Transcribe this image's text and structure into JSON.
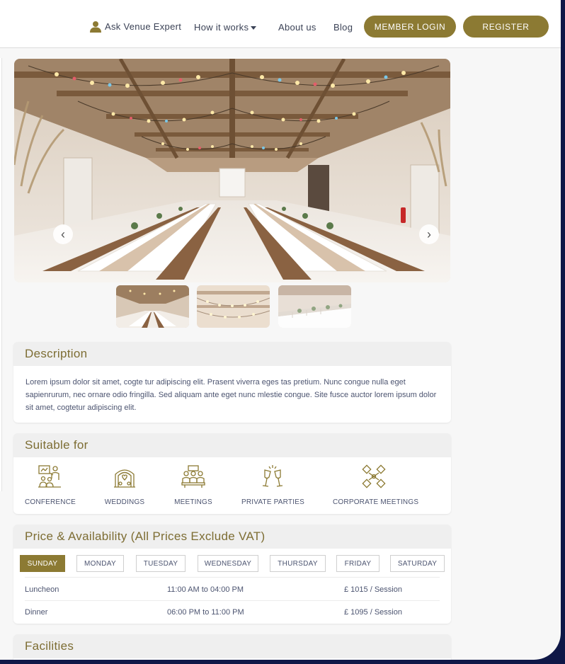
{
  "nav": {
    "ask_label": "Ask Venue Expert",
    "how_label": "How it works",
    "about_label": "About us",
    "blog_label": "Blog",
    "login_label": "MEMBER LOGIN",
    "register_label": "REGISTER"
  },
  "gallery": {
    "prev_glyph": "‹",
    "next_glyph": "›",
    "thumbnail_count": 3
  },
  "description": {
    "title": "Description",
    "text": "Lorem ipsum dolor sit amet, cogte tur adipiscing elit. Prasent viverra eges tas pretium. Nunc congue nulla eget sapienrurum, nec ornare odio fringilla. Sed aliquam ante eget nunc mlestie congue. Site fusce auctor lorem ipsum dolor sit amet, cogtetur adipiscing elit."
  },
  "suitable": {
    "title": "Suitable for",
    "items": [
      {
        "label": "CONFERENCE",
        "icon": "conference-icon"
      },
      {
        "label": "WEDDINGS",
        "icon": "wedding-icon"
      },
      {
        "label": "MEETINGS",
        "icon": "meetings-icon"
      },
      {
        "label": "PRIVATE PARTIES",
        "icon": "champagne-icon"
      },
      {
        "label": "CORPORATE MEETINGS",
        "icon": "handshake-icon"
      }
    ]
  },
  "pricing": {
    "title": "Price & Availability (All Prices Exclude VAT)",
    "days": [
      "SUNDAY",
      "MONDAY",
      "TUESDAY",
      "WEDNESDAY",
      "THURSDAY",
      "FRIDAY",
      "SATURDAY"
    ],
    "active_day": "SUNDAY",
    "sessions": [
      {
        "name": "Luncheon",
        "time": "11:00 AM to 04:00 PM",
        "price": "£ 1015 / Session"
      },
      {
        "name": "Dinner",
        "time": "06:00 PM to 11:00 PM",
        "price": "£ 1095 / Session"
      }
    ]
  },
  "facilities": {
    "title": "Facilities"
  },
  "colors": {
    "accent": "#8c7a33",
    "frame": "#0f1747",
    "text": "#4c5470"
  }
}
